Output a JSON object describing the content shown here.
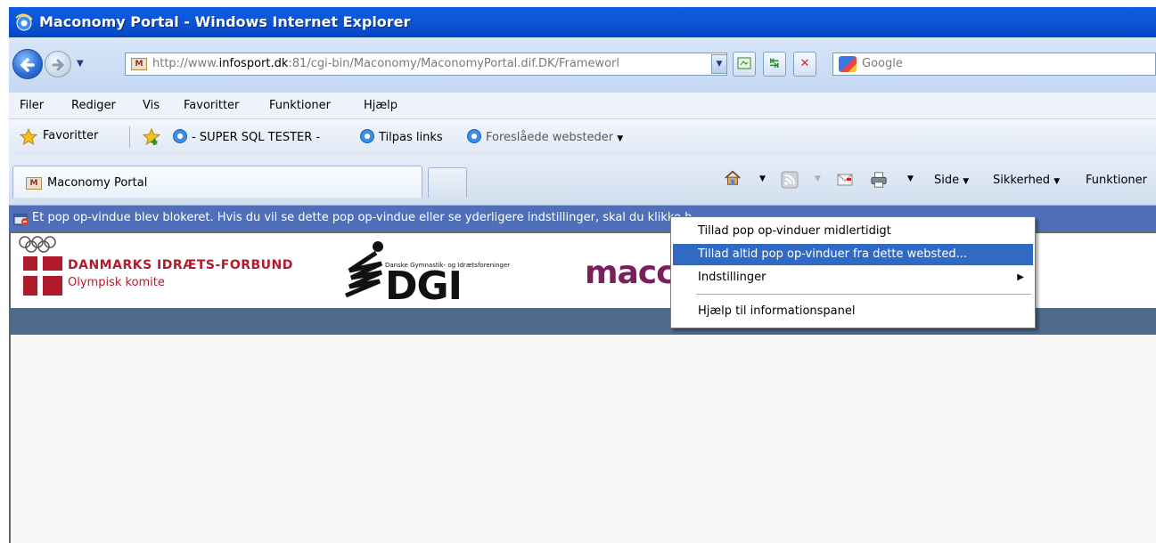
{
  "window": {
    "title": "Maconomy Portal - Windows Internet Explorer"
  },
  "address_bar": {
    "url_prefix": "http://www.",
    "url_domain": "infosport.dk",
    "url_rest": ":81/cgi-bin/Maconomy/MaconomyPortal.dif.DK/Frameworl"
  },
  "search": {
    "placeholder": "Google"
  },
  "menu": [
    "Filer",
    "Rediger",
    "Vis",
    "Favoritter",
    "Funktioner",
    "Hjælp"
  ],
  "favorites_bar": {
    "favorites_label": "Favoritter",
    "items": [
      "- SUPER SQL TESTER -",
      "Tilpas links",
      "Foreslåede websteder"
    ]
  },
  "tabs": [
    {
      "label": "Maconomy Portal"
    }
  ],
  "command_bar": {
    "page": "Side",
    "security": "Sikkerhed",
    "tools": "Funktioner"
  },
  "info_bar": {
    "text": "Et pop op-vindue blev blokeret. Hvis du vil se dette pop op-vindue eller se yderligere indstillinger, skal du klikke h"
  },
  "page": {
    "dif_name": "DANMARKS IDRÆTS-FORBUND",
    "dif_sub": "Olympisk komite",
    "dgi_small": "Danske Gymnastik- og Idrætsforeninger",
    "dgi_text": "DGI",
    "maconomy_partial": "macc"
  },
  "context_menu": {
    "items": [
      {
        "label": "Tillad pop op-vinduer midlertidigt"
      },
      {
        "label": "Tillad altid pop op-vinduer fra dette websted...",
        "selected": true
      },
      {
        "label": "Indstillinger",
        "submenu": true
      },
      {
        "label": "Hjælp til informationspanel"
      }
    ]
  },
  "colors": {
    "titlebar": "#0a5ee0",
    "infobar": "#4f6fb8",
    "selection": "#316ac5",
    "band": "#4e6a8c",
    "dif_red": "#b01c2e",
    "maconomy_purple": "#7a1e5c"
  }
}
